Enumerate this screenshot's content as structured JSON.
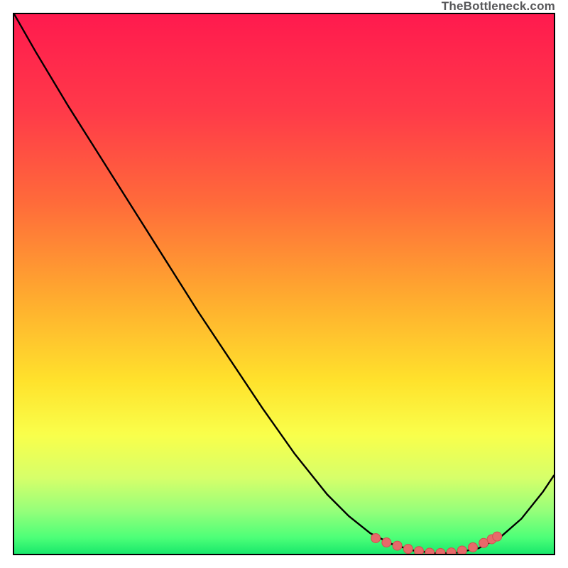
{
  "watermark": "TheBottleneck.com",
  "colors": {
    "gradient_stops": [
      {
        "offset": 0.0,
        "color": "#ff1a4e"
      },
      {
        "offset": 0.18,
        "color": "#ff3a49"
      },
      {
        "offset": 0.35,
        "color": "#ff6b3a"
      },
      {
        "offset": 0.52,
        "color": "#ffa92f"
      },
      {
        "offset": 0.68,
        "color": "#ffe22c"
      },
      {
        "offset": 0.78,
        "color": "#f9ff4b"
      },
      {
        "offset": 0.86,
        "color": "#d6ff6a"
      },
      {
        "offset": 0.92,
        "color": "#96ff7a"
      },
      {
        "offset": 0.97,
        "color": "#4dff78"
      },
      {
        "offset": 1.0,
        "color": "#19e86b"
      }
    ],
    "curve": "#000000",
    "marker": "#e76a6a",
    "marker_stroke": "#d24f4f"
  },
  "chart_data": {
    "type": "line",
    "title": "",
    "xlabel": "",
    "ylabel": "",
    "xlim": [
      0,
      100
    ],
    "ylim": [
      0,
      100
    ],
    "series": [
      {
        "name": "bottleneck-curve",
        "x": [
          0,
          4,
          10,
          16,
          22,
          28,
          34,
          40,
          46,
          52,
          58,
          62,
          66,
          70,
          74,
          78,
          82,
          86,
          90,
          94,
          98,
          100
        ],
        "y": [
          100,
          93,
          83,
          73.5,
          64,
          54.5,
          45,
          36,
          27,
          18.5,
          11,
          7,
          3.8,
          1.8,
          0.6,
          0.1,
          0.2,
          1.0,
          3.0,
          6.5,
          11.5,
          14.5
        ]
      }
    ],
    "markers": {
      "name": "highlight-dots",
      "x": [
        67,
        69,
        71,
        73,
        75,
        77,
        79,
        81,
        83,
        85,
        87,
        88.5,
        89.5
      ],
      "y": [
        2.9,
        2.1,
        1.5,
        0.9,
        0.5,
        0.2,
        0.15,
        0.25,
        0.6,
        1.2,
        2.0,
        2.7,
        3.2
      ]
    }
  }
}
